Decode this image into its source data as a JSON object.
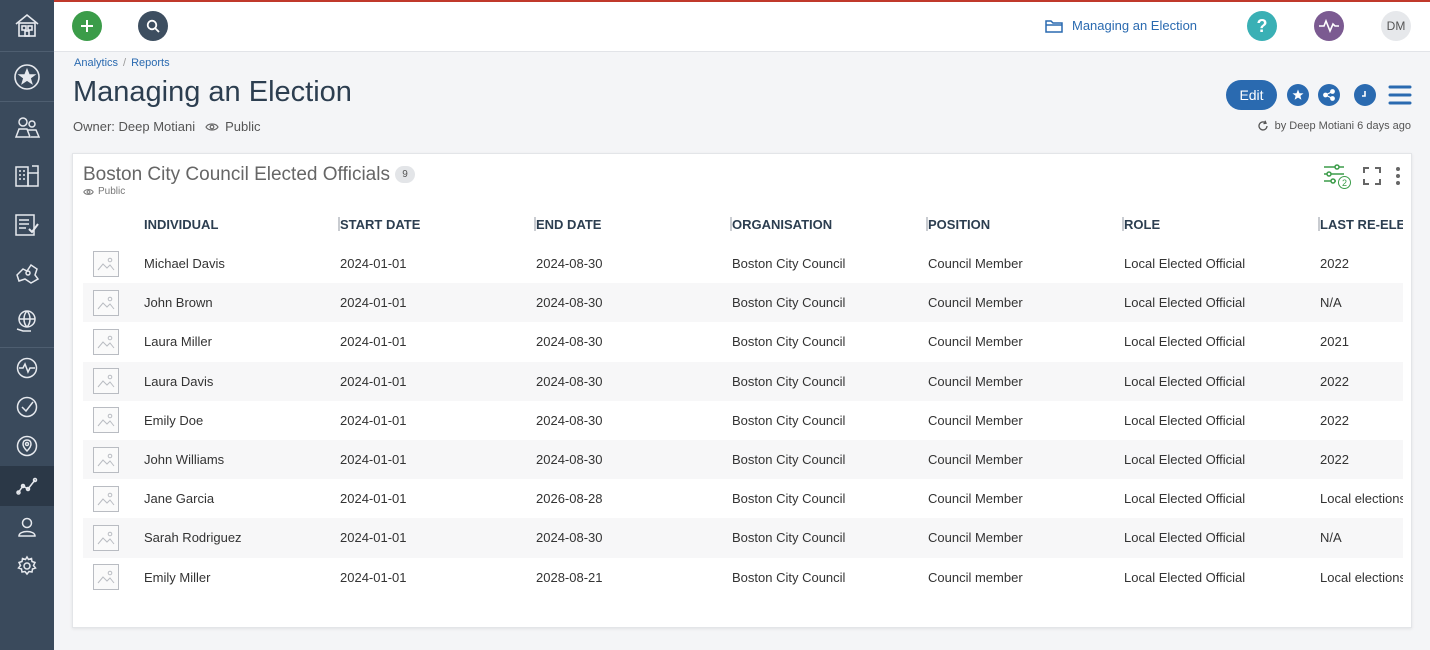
{
  "sidebar": {
    "items": [
      {
        "name": "home"
      },
      {
        "name": "favorites"
      },
      {
        "name": "people"
      },
      {
        "name": "organisations"
      },
      {
        "name": "tasks"
      },
      {
        "name": "regions"
      },
      {
        "name": "topics"
      },
      {
        "name": "activity"
      },
      {
        "name": "approvals"
      },
      {
        "name": "locations"
      },
      {
        "name": "analytics"
      },
      {
        "name": "profile"
      },
      {
        "name": "settings"
      }
    ]
  },
  "topbar": {
    "folder_label": "Managing an Election",
    "help_label": "?",
    "user_initials": "DM"
  },
  "breadcrumb": {
    "items": [
      "Analytics",
      "Reports"
    ],
    "separator": "/"
  },
  "page": {
    "title": "Managing an Election",
    "owner_label": "Owner: Deep Motiani",
    "visibility": "Public",
    "edit_label": "Edit",
    "updated_text": "by Deep Motiani 6 days ago"
  },
  "report": {
    "title": "Boston City Council Elected Officials",
    "count": "9",
    "visibility": "Public",
    "filter_count": "2",
    "columns": [
      "INDIVIDUAL",
      "START DATE",
      "END DATE",
      "ORGANISATION",
      "POSITION",
      "ROLE",
      "LAST RE-ELEC"
    ],
    "rows": [
      [
        "Michael Davis",
        "2024-01-01",
        "2024-08-30",
        "Boston City Council",
        "Council Member",
        "Local Elected Official",
        "2022"
      ],
      [
        "John Brown",
        "2024-01-01",
        "2024-08-30",
        "Boston City Council",
        "Council Member",
        "Local Elected Official",
        "N/A"
      ],
      [
        "Laura Miller",
        "2024-01-01",
        "2024-08-30",
        "Boston City Council",
        "Council Member",
        "Local Elected Official",
        "2021"
      ],
      [
        "Laura Davis",
        "2024-01-01",
        "2024-08-30",
        "Boston City Council",
        "Council Member",
        "Local Elected Official",
        "2022"
      ],
      [
        "Emily Doe",
        "2024-01-01",
        "2024-08-30",
        "Boston City Council",
        "Council Member",
        "Local Elected Official",
        "2022"
      ],
      [
        "John Williams",
        "2024-01-01",
        "2024-08-30",
        "Boston City Council",
        "Council Member",
        "Local Elected Official",
        "2022"
      ],
      [
        "Jane Garcia",
        "2024-01-01",
        "2026-08-28",
        "Boston City Council",
        "Council Member",
        "Local Elected Official",
        "Local elections"
      ],
      [
        "Sarah Rodriguez",
        "2024-01-01",
        "2024-08-30",
        "Boston City Council",
        "Council Member",
        "Local Elected Official",
        "N/A"
      ],
      [
        "Emily Miller",
        "2024-01-01",
        "2028-08-21",
        "Boston City Council",
        "Council member",
        "Local Elected Official",
        "Local elections"
      ]
    ]
  },
  "colors": {
    "sidebar_bg": "#3a4a5c",
    "accent_blue": "#2a6ab0",
    "add_green": "#3b9c49",
    "help_teal": "#3ab0b5",
    "pulse_purple": "#7b5a91",
    "topline_red": "#c0392b"
  }
}
